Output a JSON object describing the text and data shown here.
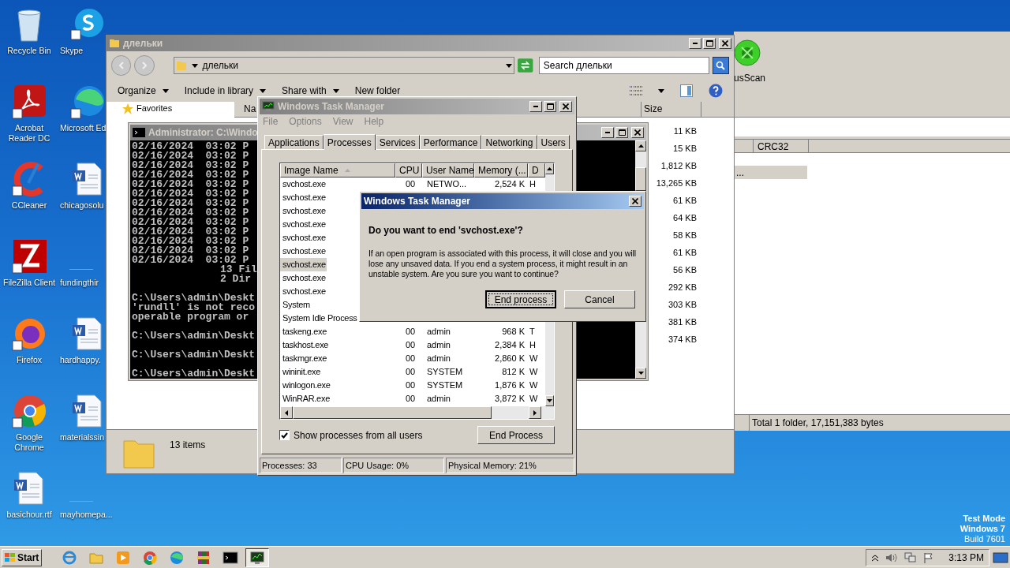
{
  "desktop_icons": [
    {
      "label": "Recycle Bin",
      "kind": "recycle"
    },
    {
      "label": "Skype",
      "kind": "skype"
    },
    {
      "label": "Acrobat Reader DC",
      "kind": "acrobat"
    },
    {
      "label": "Microsoft Ed",
      "kind": "edge"
    },
    {
      "label": "CCleaner",
      "kind": "ccleaner"
    },
    {
      "label": "chicagosolu",
      "kind": "word"
    },
    {
      "label": "FileZilla Client",
      "kind": "filezilla"
    },
    {
      "label": "fundingthir",
      "kind": "blank"
    },
    {
      "label": "Firefox",
      "kind": "firefox"
    },
    {
      "label": "hardhappy.",
      "kind": "word"
    },
    {
      "label": "Google Chrome",
      "kind": "chrome"
    },
    {
      "label": "materialssin",
      "kind": "word"
    },
    {
      "label": "basichour.rtf",
      "kind": "word"
    },
    {
      "label": "mayhomepa...",
      "kind": "blank"
    }
  ],
  "winrar": {
    "toolbar_label": "usScan",
    "columns": [
      "CRC32"
    ],
    "selected_row": "...",
    "status": "Total 1 folder, 17,151,383 bytes"
  },
  "explorer": {
    "title": "длельки",
    "address": "длельки",
    "search_placeholder": "Search длельки",
    "toolbar": [
      "Organize",
      "Include in library",
      "Share with",
      "New folder"
    ],
    "nav": [
      "Favorites"
    ],
    "columns": [
      "Na",
      "Size"
    ],
    "sizes": [
      "11 KB",
      "15 KB",
      "1,812 KB",
      "13,265 KB",
      "61 KB",
      "64 KB",
      "58 KB",
      "61 KB",
      "56 KB",
      "292 KB",
      "303 KB",
      "381 KB",
      "374 KB"
    ],
    "item_count": "13 items"
  },
  "cmd": {
    "title": "Administrator: C:\\Windo",
    "lines": [
      {
        "kind": "text",
        "text": "02/16/2024  03:02 P"
      },
      {
        "kind": "text",
        "text": "02/16/2024  03:02 P"
      },
      {
        "kind": "text",
        "text": "02/16/2024  03:02 P"
      },
      {
        "kind": "text",
        "text": "02/16/2024  03:02 P"
      },
      {
        "kind": "text",
        "text": "02/16/2024  03:02 P"
      },
      {
        "kind": "text",
        "text": "02/16/2024  03:02 P"
      },
      {
        "kind": "text",
        "text": "02/16/2024  03:02 P"
      },
      {
        "kind": "text",
        "text": "02/16/2024  03:02 P"
      },
      {
        "kind": "text",
        "text": "02/16/2024  03:02 P"
      },
      {
        "kind": "text",
        "text": "02/16/2024  03:02 P"
      },
      {
        "kind": "text",
        "text": "02/16/2024  03:02 P"
      },
      {
        "kind": "text",
        "text": "02/16/2024  03:02 P"
      },
      {
        "kind": "text",
        "text": "02/16/2024  03:02 P"
      },
      {
        "kind": "summary",
        "text": "13 Fil"
      },
      {
        "kind": "summary",
        "text": "2 Dir"
      },
      {
        "kind": "blank"
      },
      {
        "kind": "text",
        "text": "C:\\Users\\admin\\Deskt"
      },
      {
        "kind": "text",
        "text": "'rundll' is not reco"
      },
      {
        "kind": "text",
        "text": "operable program or"
      },
      {
        "kind": "blank"
      },
      {
        "kind": "text",
        "text": "C:\\Users\\admin\\Deskt"
      },
      {
        "kind": "blank"
      },
      {
        "kind": "text",
        "text": "C:\\Users\\admin\\Deskt"
      },
      {
        "kind": "blank"
      },
      {
        "kind": "text",
        "text": "C:\\Users\\admin\\Deskt"
      }
    ]
  },
  "task_manager": {
    "title": "Windows Task Manager",
    "menu": [
      "File",
      "Options",
      "View",
      "Help"
    ],
    "tabs": [
      {
        "label": "Applications",
        "selected": false
      },
      {
        "label": "Processes",
        "selected": true
      },
      {
        "label": "Services",
        "selected": false
      },
      {
        "label": "Performance",
        "selected": false
      },
      {
        "label": "Networking",
        "selected": false
      },
      {
        "label": "Users",
        "selected": false
      }
    ],
    "columns": [
      "Image Name",
      "CPU",
      "User Name",
      "Memory (...",
      "D"
    ],
    "rows": [
      {
        "name": "svchost.exe",
        "cpu": "00",
        "user": "NETWO...",
        "memory": "2,524 K",
        "description": "H",
        "selected": false
      },
      {
        "name": "svchost.exe",
        "selected": false
      },
      {
        "name": "svchost.exe",
        "selected": false
      },
      {
        "name": "svchost.exe",
        "selected": false
      },
      {
        "name": "svchost.exe",
        "selected": false
      },
      {
        "name": "svchost.exe",
        "selected": false
      },
      {
        "name": "svchost.exe",
        "selected": true
      },
      {
        "name": "svchost.exe",
        "selected": false
      },
      {
        "name": "svchost.exe",
        "selected": false
      },
      {
        "name": "System",
        "selected": false
      },
      {
        "name": "System Idle Process",
        "selected": false
      },
      {
        "name": "taskeng.exe",
        "cpu": "00",
        "user": "admin",
        "memory": "968 K",
        "description": "T",
        "selected": false
      },
      {
        "name": "taskhost.exe",
        "cpu": "00",
        "user": "admin",
        "memory": "2,384 K",
        "description": "H",
        "selected": false
      },
      {
        "name": "taskmgr.exe",
        "cpu": "00",
        "user": "admin",
        "memory": "2,860 K",
        "description": "W",
        "selected": false
      },
      {
        "name": "wininit.exe",
        "cpu": "00",
        "user": "SYSTEM",
        "memory": "812 K",
        "description": "W",
        "selected": false
      },
      {
        "name": "winlogon.exe",
        "cpu": "00",
        "user": "SYSTEM",
        "memory": "1,876 K",
        "description": "W",
        "selected": false
      },
      {
        "name": "WinRAR.exe",
        "cpu": "00",
        "user": "admin",
        "memory": "3,872 K",
        "description": "W",
        "selected": false
      }
    ],
    "show_all": {
      "label": "Show processes from all users",
      "checked": true
    },
    "end_button": "End Process",
    "status": [
      "Processes: 33",
      "CPU Usage: 0%",
      "Physical Memory: 21%"
    ]
  },
  "dialog": {
    "title": "Windows Task Manager",
    "question": "Do you want to end 'svchost.exe'?",
    "message": "If an open program is associated with this process, it will close and you will lose any unsaved data. If you end a system process, it might result in an unstable system. Are you sure you want to continue?",
    "buttons": [
      {
        "label": "End process",
        "default": true
      },
      {
        "label": "Cancel",
        "default": false
      }
    ]
  },
  "taskbar": {
    "start": "Start",
    "apps": [
      {
        "kind": "ie",
        "active": false
      },
      {
        "kind": "folder",
        "active": false
      },
      {
        "kind": "media",
        "active": false
      },
      {
        "kind": "chrome",
        "active": false
      },
      {
        "kind": "edge",
        "active": false
      },
      {
        "kind": "winrar",
        "active": false
      },
      {
        "kind": "cmd",
        "active": false
      },
      {
        "kind": "taskmgr",
        "active": true
      }
    ],
    "clock": "3:13 PM"
  },
  "system_note": [
    "Test Mode",
    "Windows 7",
    "Build 7601"
  ]
}
